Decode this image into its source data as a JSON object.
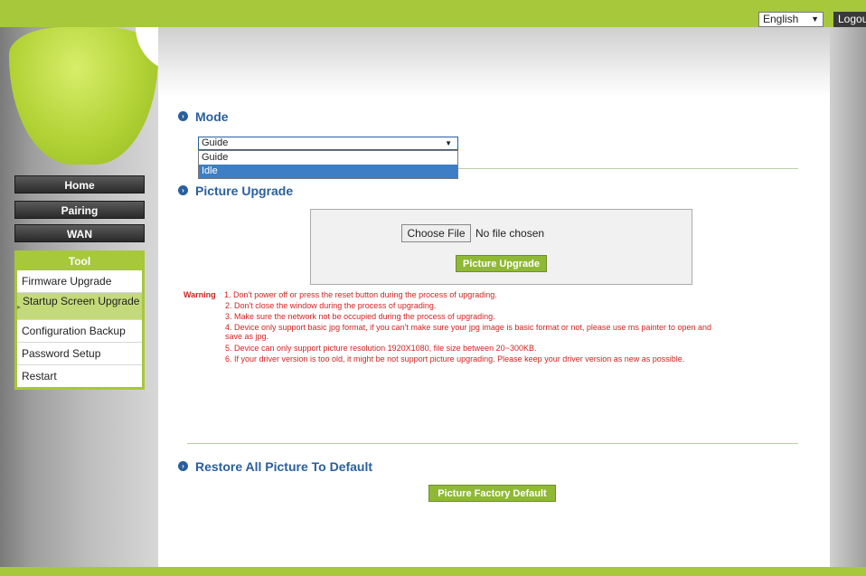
{
  "header": {
    "language": "English",
    "logout_label": "Logout"
  },
  "nav": {
    "home": "Home",
    "pairing": "Pairing",
    "wan": "WAN",
    "tool": "Tool",
    "tool_items": [
      "Firmware Upgrade",
      "Startup Screen Upgrade",
      "Configuration Backup",
      "Password Setup",
      "Restart"
    ],
    "active_item": "Startup Screen Upgrade"
  },
  "mode": {
    "title": "Mode",
    "selected": "Guide",
    "options": [
      "Guide",
      "Idle"
    ],
    "highlighted": "Idle"
  },
  "picture_upgrade": {
    "title": "Picture Upgrade",
    "choose_file": "Choose File",
    "no_file": "No file chosen",
    "button": "Picture Upgrade"
  },
  "warning": {
    "label": "Warning",
    "items": [
      "1. Don't power off or press the reset button during the process of upgrading.",
      "2. Don't close the window during the process of upgrading.",
      "3. Make sure the network not be occupied during the process of upgrading.",
      "4. Device only support basic jpg format, if you can't make sure your jpg image is basic format or not, please use ms painter to open and",
      "save as jpg.",
      "5. Device can only support picture resolution 1920X1080, file size between 20~300KB.",
      "6. If your driver version is too old, it might be not support picture upgrading. Please keep your driver version as new as possible."
    ]
  },
  "restore": {
    "title": "Restore All Picture To Default",
    "button": "Picture Factory Default"
  },
  "colors": {
    "lime": "#a6c83a",
    "title_blue": "#2a5f9c",
    "warning_red": "#d32222",
    "button_green": "#8fb935"
  }
}
